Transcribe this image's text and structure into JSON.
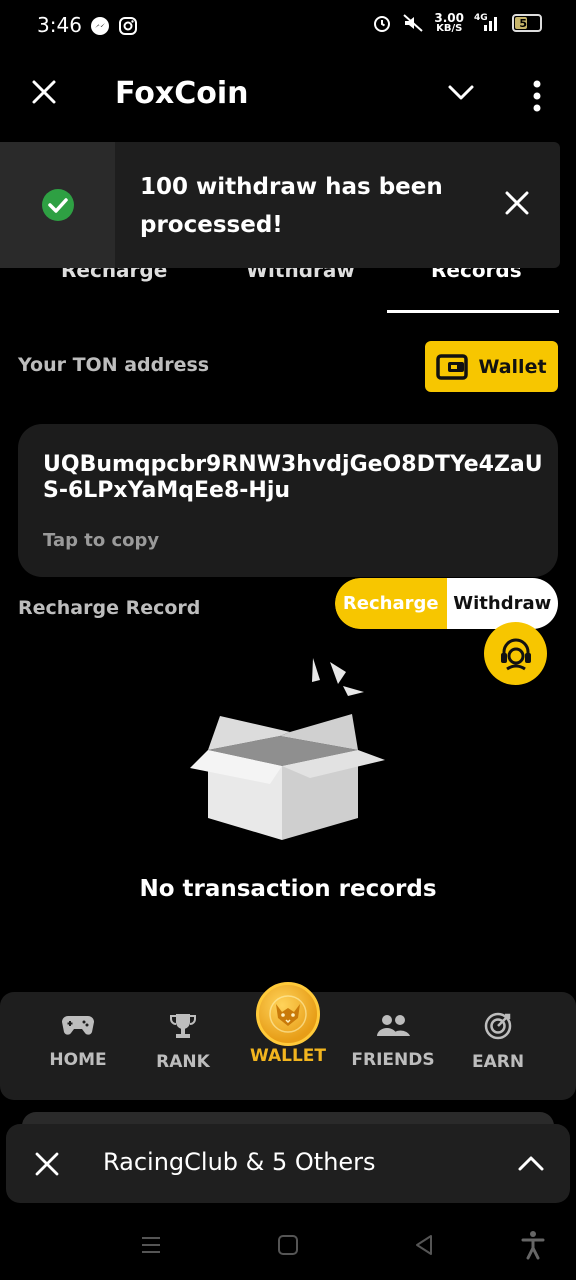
{
  "status_bar": {
    "time": "3:46",
    "speed_value": "3.00",
    "speed_unit": "KB/S",
    "network": "4G",
    "battery": "51"
  },
  "header": {
    "title": "FoxCoin"
  },
  "toast": {
    "message": "100 withdraw has been processed!"
  },
  "tabs": [
    {
      "label": "Recharge"
    },
    {
      "label": "Withdraw"
    },
    {
      "label": "Records"
    }
  ],
  "address_section": {
    "label": "Your TON address",
    "wallet_button": "Wallet",
    "address": "UQBumqpcbr9RNW3hvdjGeO8DTYe4ZaUS-6LPxYaMqEe8-Hju",
    "tap_to_copy": "Tap to copy"
  },
  "records": {
    "title": "Recharge Record",
    "toggle": [
      "Recharge",
      "Withdraw"
    ],
    "empty_text": "No transaction records"
  },
  "bottom_nav": [
    {
      "label": "HOME",
      "icon": "gamepad-icon"
    },
    {
      "label": "RANK",
      "icon": "trophy-icon"
    },
    {
      "label": "WALLET",
      "icon": "fox-coin-icon"
    },
    {
      "label": "FRIENDS",
      "icon": "people-icon"
    },
    {
      "label": "EARN",
      "icon": "target-icon"
    }
  ],
  "notification": {
    "text": "RacingClub & 5 Others"
  },
  "colors": {
    "accent": "#f7c600",
    "background": "#000000",
    "card": "#1c1c1c",
    "success": "#2ea043"
  }
}
